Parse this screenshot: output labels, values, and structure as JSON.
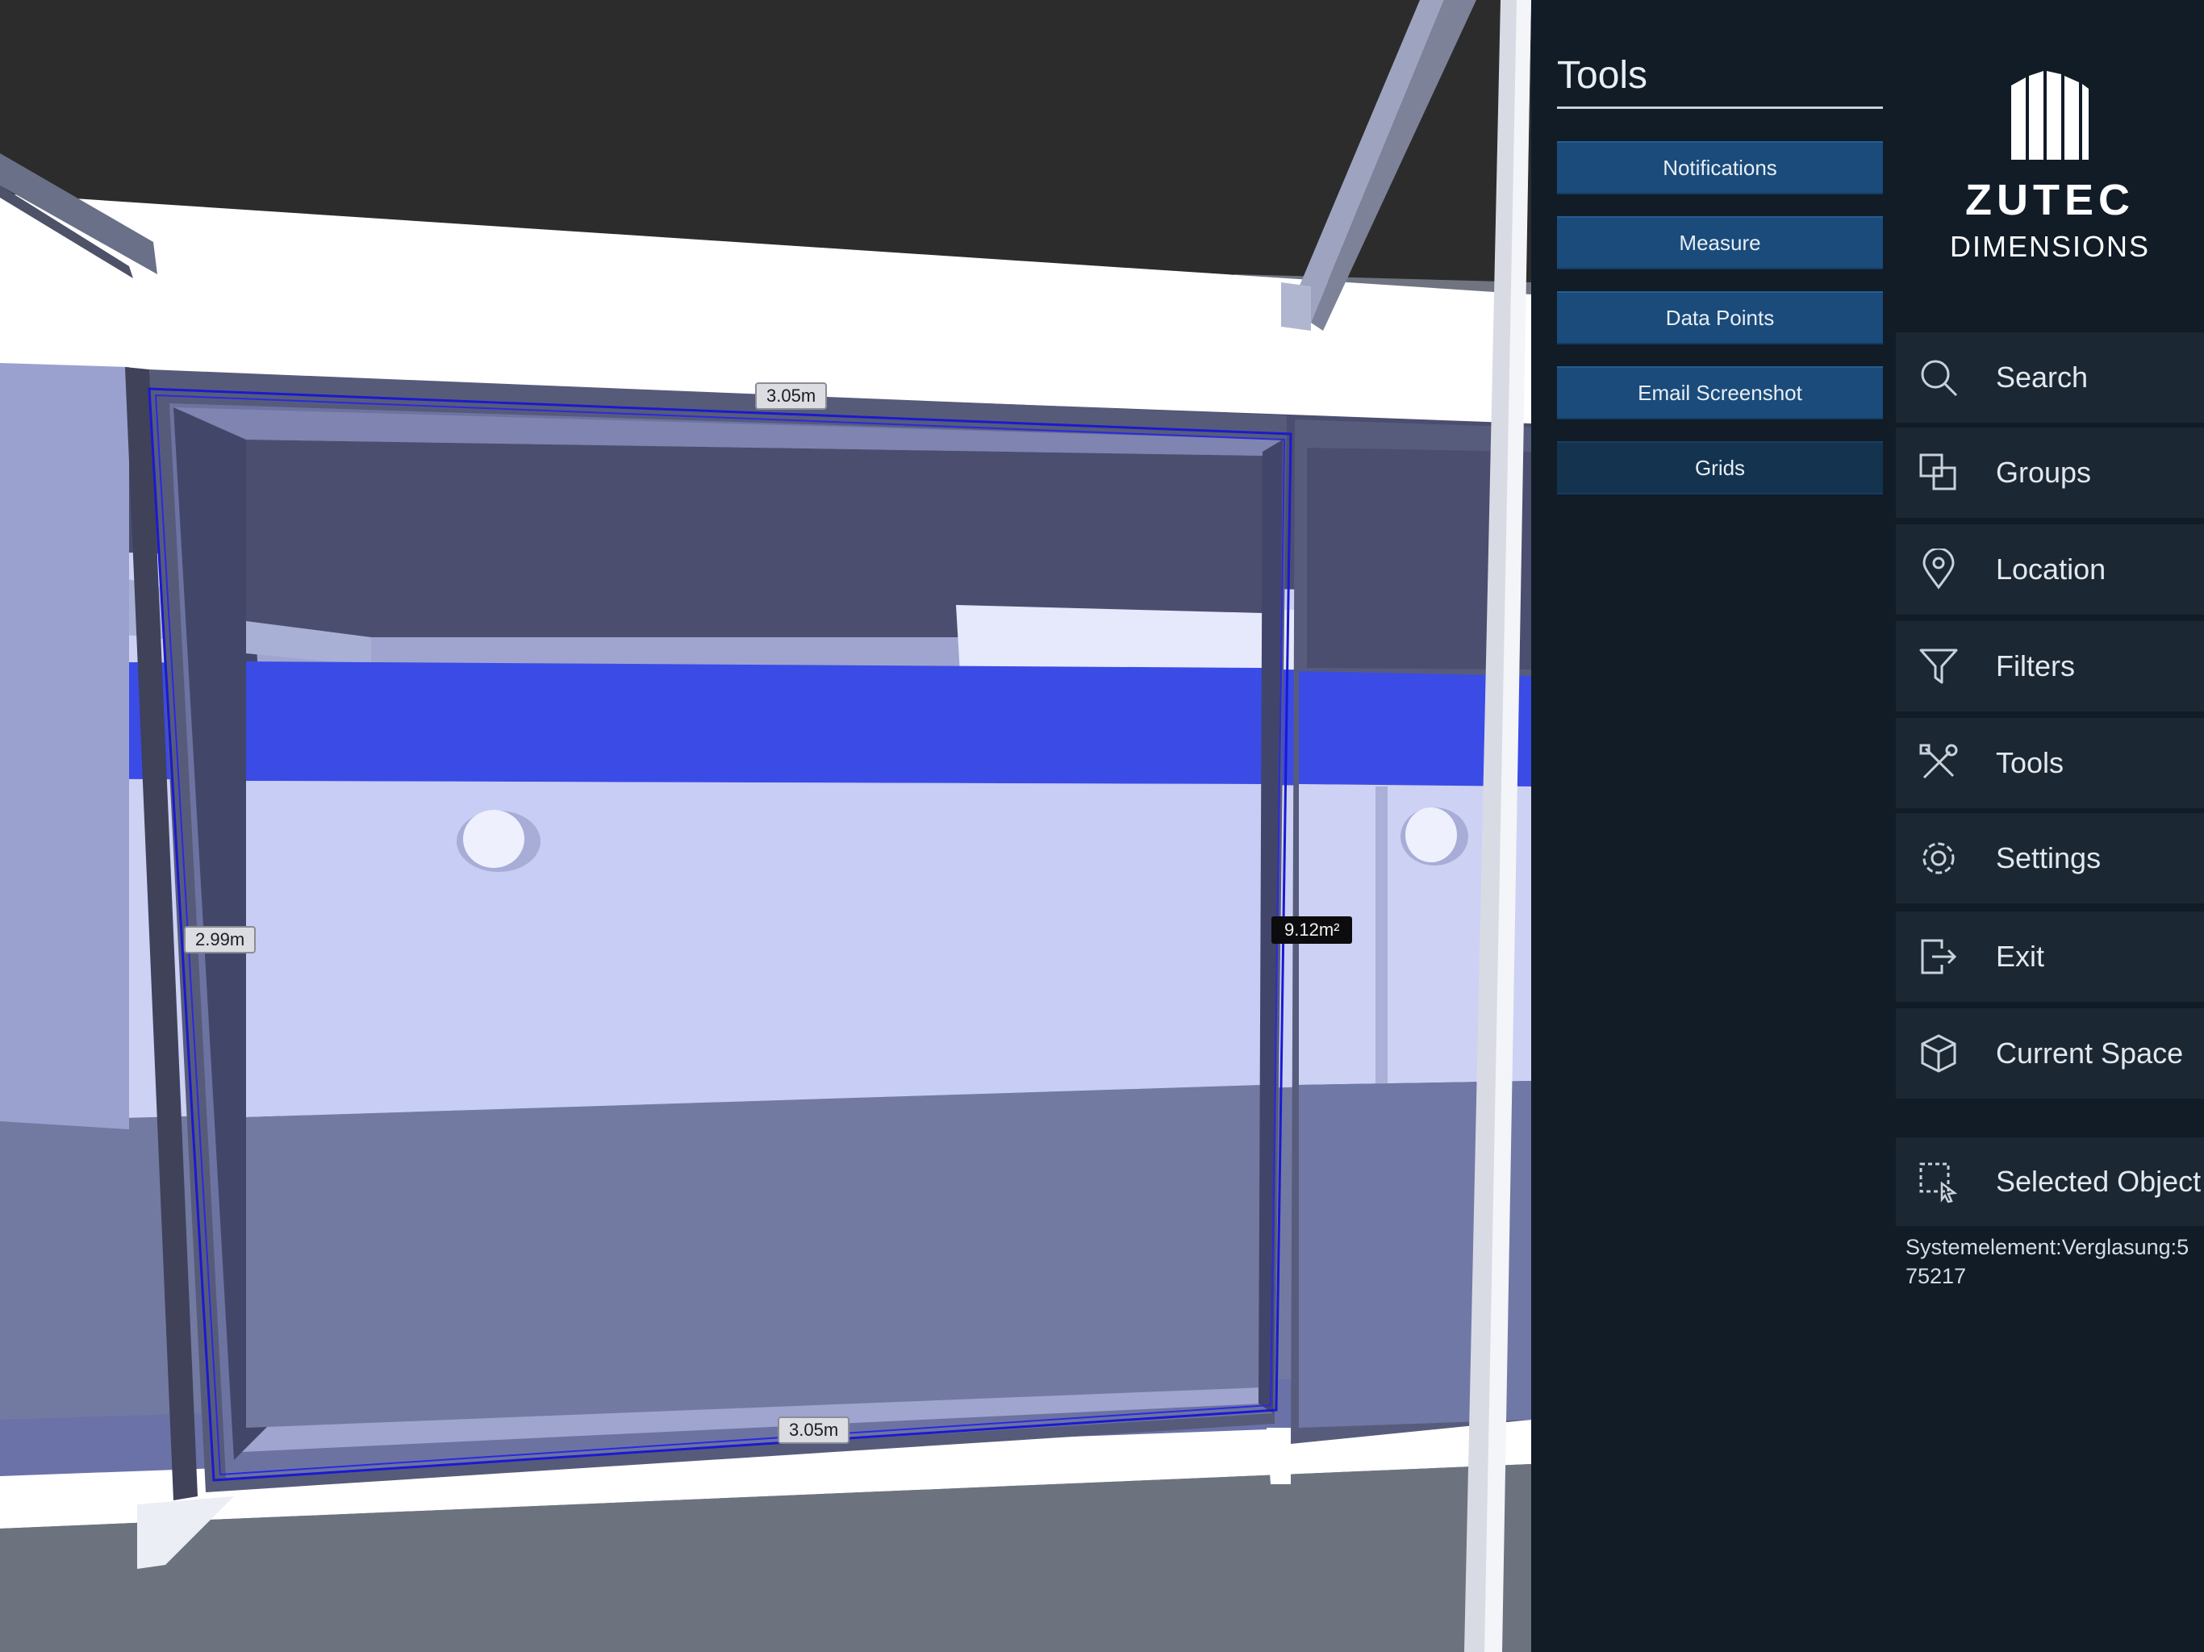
{
  "viewport": {
    "measurements": {
      "top_width": "3.05m",
      "bottom_width": "3.05m",
      "height": "2.99m",
      "area": "9.12m²"
    }
  },
  "tools_popout": {
    "title": "Tools",
    "buttons": [
      {
        "label": "Notifications"
      },
      {
        "label": "Measure"
      },
      {
        "label": "Data Points"
      },
      {
        "label": "Email Screenshot"
      },
      {
        "label": "Grids"
      }
    ]
  },
  "logo": {
    "brand": "ZUTEC",
    "product": "DIMENSIONS"
  },
  "nav": {
    "items": [
      {
        "label": "Search",
        "icon": "search-icon"
      },
      {
        "label": "Groups",
        "icon": "groups-icon"
      },
      {
        "label": "Location",
        "icon": "location-pin-icon"
      },
      {
        "label": "Filters",
        "icon": "filter-icon"
      },
      {
        "label": "Tools",
        "icon": "tools-icon"
      },
      {
        "label": "Settings",
        "icon": "gear-icon"
      },
      {
        "label": "Exit",
        "icon": "exit-icon"
      },
      {
        "label": "Current Space",
        "icon": "cube-icon"
      }
    ],
    "selected_object": {
      "label": "Selected Object",
      "icon": "selection-cursor-icon",
      "value": "Systemelement:Verglasung:575217"
    }
  },
  "colors": {
    "panel_bg": "#111c27",
    "nav_item_bg": "#1b2732",
    "tool_button_bg": "#1a4b7a",
    "measure_outline": "#1a1ad0",
    "beam_blue": "#3a4be6"
  }
}
